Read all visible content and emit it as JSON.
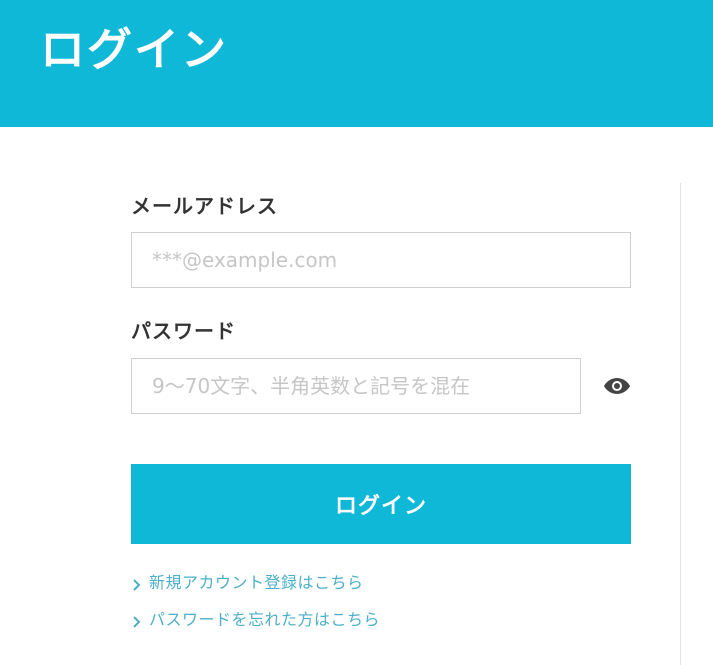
{
  "header": {
    "title": "ログイン"
  },
  "form": {
    "email": {
      "label": "メールアドレス",
      "placeholder": "***@example.com",
      "value": ""
    },
    "password": {
      "label": "パスワード",
      "placeholder": "9〜70文字、半角英数と記号を混在",
      "value": "",
      "toggle_icon": "eye-icon"
    },
    "submit_label": "ログイン"
  },
  "links": {
    "register": "新規アカウント登録はこちら",
    "forgot_password": "パスワードを忘れた方はこちら"
  },
  "colors": {
    "accent": "#10b8d8",
    "link": "#4db0c8",
    "label_text": "#333333",
    "input_border": "#d0d0d0"
  }
}
